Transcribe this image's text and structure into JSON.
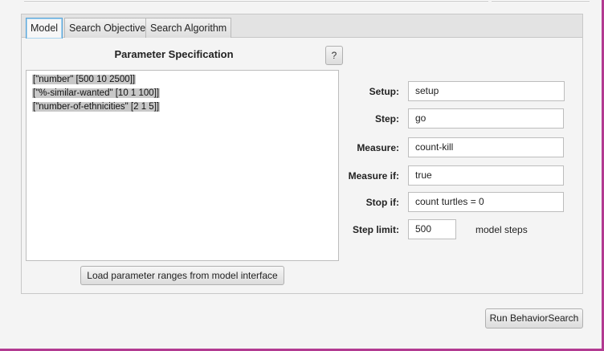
{
  "tabs": [
    {
      "label": "Model"
    },
    {
      "label": "Search Objective"
    },
    {
      "label": "Search Algorithm"
    }
  ],
  "param_section": {
    "title": "Parameter Specification",
    "help_label": "?",
    "lines": [
      "[\"number\" [500 10 2500]]",
      "[\"%-similar-wanted\" [10 1 100]]",
      "[\"number-of-ethnicities\" [2 1 5]]"
    ],
    "load_button_label": "Load parameter ranges from model interface"
  },
  "fields": {
    "setup": {
      "label": "Setup:",
      "value": "setup"
    },
    "step": {
      "label": "Step:",
      "value": "go"
    },
    "measure": {
      "label": "Measure:",
      "value": "count-kill"
    },
    "measure_if": {
      "label": "Measure if:",
      "value": "true"
    },
    "stop_if": {
      "label": "Stop if:",
      "value": "count turtles = 0"
    },
    "step_limit": {
      "label": "Step limit:",
      "value": "500",
      "suffix": "model steps"
    }
  },
  "run_button_label": "Run BehaviorSearch"
}
